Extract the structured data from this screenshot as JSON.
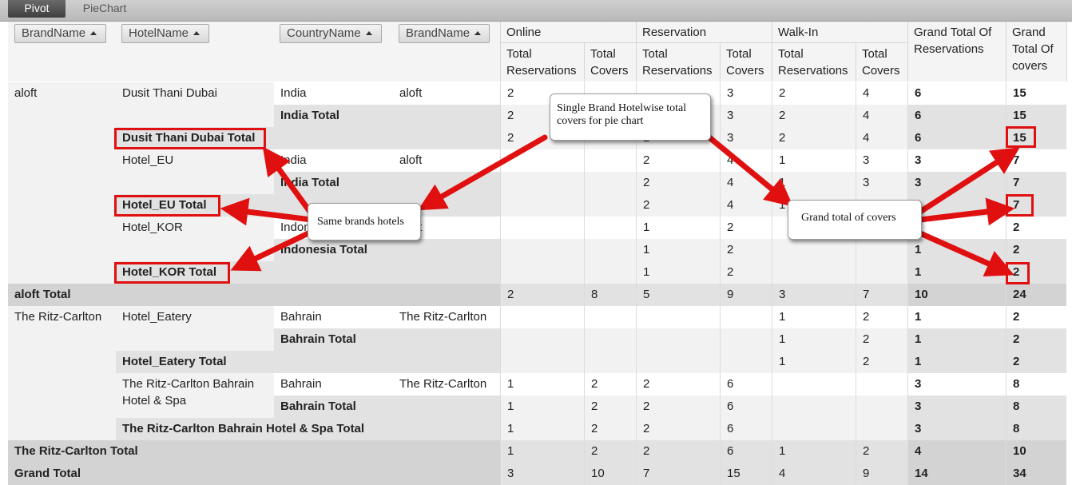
{
  "tabs": [
    {
      "label": "Pivot"
    },
    {
      "label": "PieChart"
    }
  ],
  "row_fields": [
    "BrandName",
    "HotelName",
    "CountryName",
    "BrandName"
  ],
  "column_groups": [
    "Online",
    "Reservation",
    "Walk-In"
  ],
  "measure_labels": {
    "total_reservations": "Total Reservations",
    "total_covers": "Total Covers"
  },
  "grand_headers": {
    "reservations": "Grand Total Of Reservations",
    "covers": "Grand Total Of covers"
  },
  "row_labels": {
    "brand1": "aloft",
    "hotel1": "Dusit Thani Dubai",
    "hotel1_country": "India",
    "hotel1_brand": "aloft",
    "hotel1_country_total": "India Total",
    "hotel1_total": "Dusit Thani Dubai Total",
    "hotel2": "Hotel_EU",
    "hotel2_country": "India",
    "hotel2_brand": "aloft",
    "hotel2_country_total": "India Total",
    "hotel2_total": "Hotel_EU Total",
    "hotel3": "Hotel_KOR",
    "hotel3_country": "Indonesia",
    "hotel3_brand": "aloft",
    "hotel3_country_total": "Indonesia Total",
    "hotel3_total": "Hotel_KOR Total",
    "brand1_total": "aloft Total",
    "brand2": "The Ritz-Carlton",
    "hotel4": "Hotel_Eatery",
    "hotel4_country": "Bahrain",
    "hotel4_brand": "The Ritz-Carlton",
    "hotel4_country_total": "Bahrain Total",
    "hotel4_total": "Hotel_Eatery Total",
    "hotel5": "The Ritz-Carlton Bahrain Hotel & Spa",
    "hotel5_country": "Bahrain",
    "hotel5_brand": "The Ritz-Carlton",
    "hotel5_country_total": "Bahrain Total",
    "hotel5_total": "The Ritz-Carlton Bahrain Hotel & Spa Total",
    "brand2_total": "The Ritz-Carlton Total",
    "grand_total": "Grand Total"
  },
  "table": {
    "rows": [
      [
        "2",
        "",
        "",
        "3",
        "2",
        "4",
        "6",
        "15"
      ],
      [
        "2",
        "",
        "",
        "3",
        "2",
        "4",
        "6",
        "15"
      ],
      [
        "2",
        "",
        "2",
        "3",
        "2",
        "4",
        "6",
        "15"
      ],
      [
        "",
        "",
        "2",
        "4",
        "1",
        "3",
        "3",
        "7"
      ],
      [
        "",
        "",
        "2",
        "4",
        "1",
        "3",
        "3",
        "7"
      ],
      [
        "",
        "",
        "2",
        "4",
        "1",
        "",
        "",
        "7"
      ],
      [
        "",
        "",
        "1",
        "2",
        "",
        "",
        "",
        "2"
      ],
      [
        "",
        "",
        "1",
        "2",
        "",
        "",
        "1",
        "2"
      ],
      [
        "",
        "",
        "1",
        "2",
        "",
        "",
        "1",
        "2"
      ],
      [
        "2",
        "8",
        "5",
        "9",
        "3",
        "7",
        "10",
        "24"
      ],
      [
        "",
        "",
        "",
        "",
        "1",
        "2",
        "1",
        "2"
      ],
      [
        "",
        "",
        "",
        "",
        "1",
        "2",
        "1",
        "2"
      ],
      [
        "",
        "",
        "",
        "",
        "1",
        "2",
        "1",
        "2"
      ],
      [
        "1",
        "2",
        "2",
        "6",
        "",
        "",
        "3",
        "8"
      ],
      [
        "1",
        "2",
        "2",
        "6",
        "",
        "",
        "3",
        "8"
      ],
      [
        "1",
        "2",
        "2",
        "6",
        "",
        "",
        "3",
        "8"
      ],
      [
        "1",
        "2",
        "2",
        "6",
        "1",
        "2",
        "4",
        "10"
      ],
      [
        "3",
        "10",
        "7",
        "15",
        "4",
        "9",
        "14",
        "34"
      ]
    ]
  },
  "annotations": {
    "callout_single_brand": "Single Brand Hotelwise total covers for pie chart",
    "callout_same_brands": "Same brands hotels",
    "callout_grand_total": "Grand total of covers"
  },
  "colors": {
    "highlight_box": "#e01010",
    "arrow": "#e01010"
  }
}
